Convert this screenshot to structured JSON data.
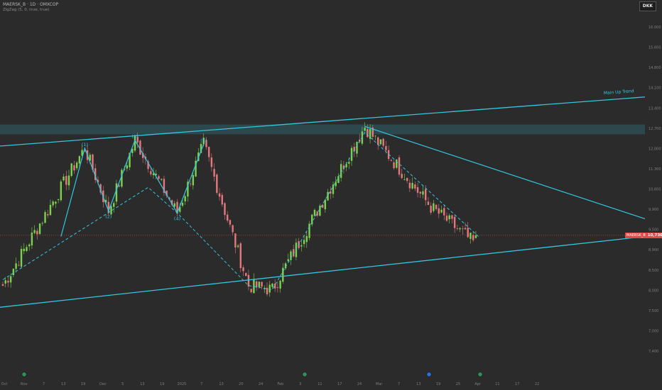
{
  "header": {
    "symbol_line": "MAERSK_B · 1D · OMXCOP",
    "study_line": "ZigZag (5, 0, true, true)"
  },
  "currency_button": "DKK",
  "price_tag": {
    "symbol": "MAERSK_B",
    "last": "10,730"
  },
  "colors": {
    "background": "#2b2b2b",
    "up_candle": "#7bd24f",
    "down_candle": "#e6787d",
    "trendline": "#33c7e0",
    "zone": "#2e4d52",
    "price_line": "#e24a4a"
  },
  "chart_data": {
    "type": "candlestick",
    "ylim": [
      7300,
      16500
    ],
    "y_ticks": [
      "16,000",
      "15,600",
      "14,800",
      "14,100",
      "13,400",
      "12,700",
      "12,000",
      "11,300",
      "10,600",
      "9,900",
      "9,500",
      "8,900",
      "8,500",
      "8,000",
      "7,500",
      "7,000",
      "7,400"
    ],
    "x_ticks": [
      "Oct",
      "Nov",
      "7",
      "13",
      "19",
      "Dec",
      "5",
      "13",
      "19",
      "2025",
      "7",
      "13",
      "20",
      "24",
      "Feb",
      "3",
      "11",
      "17",
      "24",
      "Mar",
      "7",
      "13",
      "19",
      "25",
      "Apr",
      "11",
      "17",
      "22"
    ],
    "last_price": 10730,
    "resistance_zone": [
      13300,
      13550
    ],
    "annotations": [
      {
        "type": "trendline",
        "label": "Main Up Trend",
        "start": 13000,
        "end": 14250
      },
      {
        "type": "channel_bottom",
        "start": 8900,
        "end": 10700
      },
      {
        "type": "trendline",
        "label": "",
        "start": 13500,
        "end": 11150
      }
    ],
    "waves": [
      {
        "label": "(1)",
        "price": 12950
      },
      {
        "label": "(2)",
        "price": 11350
      },
      {
        "label": "(3)",
        "price": 13150
      },
      {
        "label": "(4)",
        "price": 11300
      },
      {
        "label": "(5)",
        "price": 13050
      }
    ],
    "swing_points": [
      9450,
      12950,
      11350,
      13150,
      11300,
      13050,
      9450,
      9350,
      13500,
      11450,
      10500
    ]
  }
}
